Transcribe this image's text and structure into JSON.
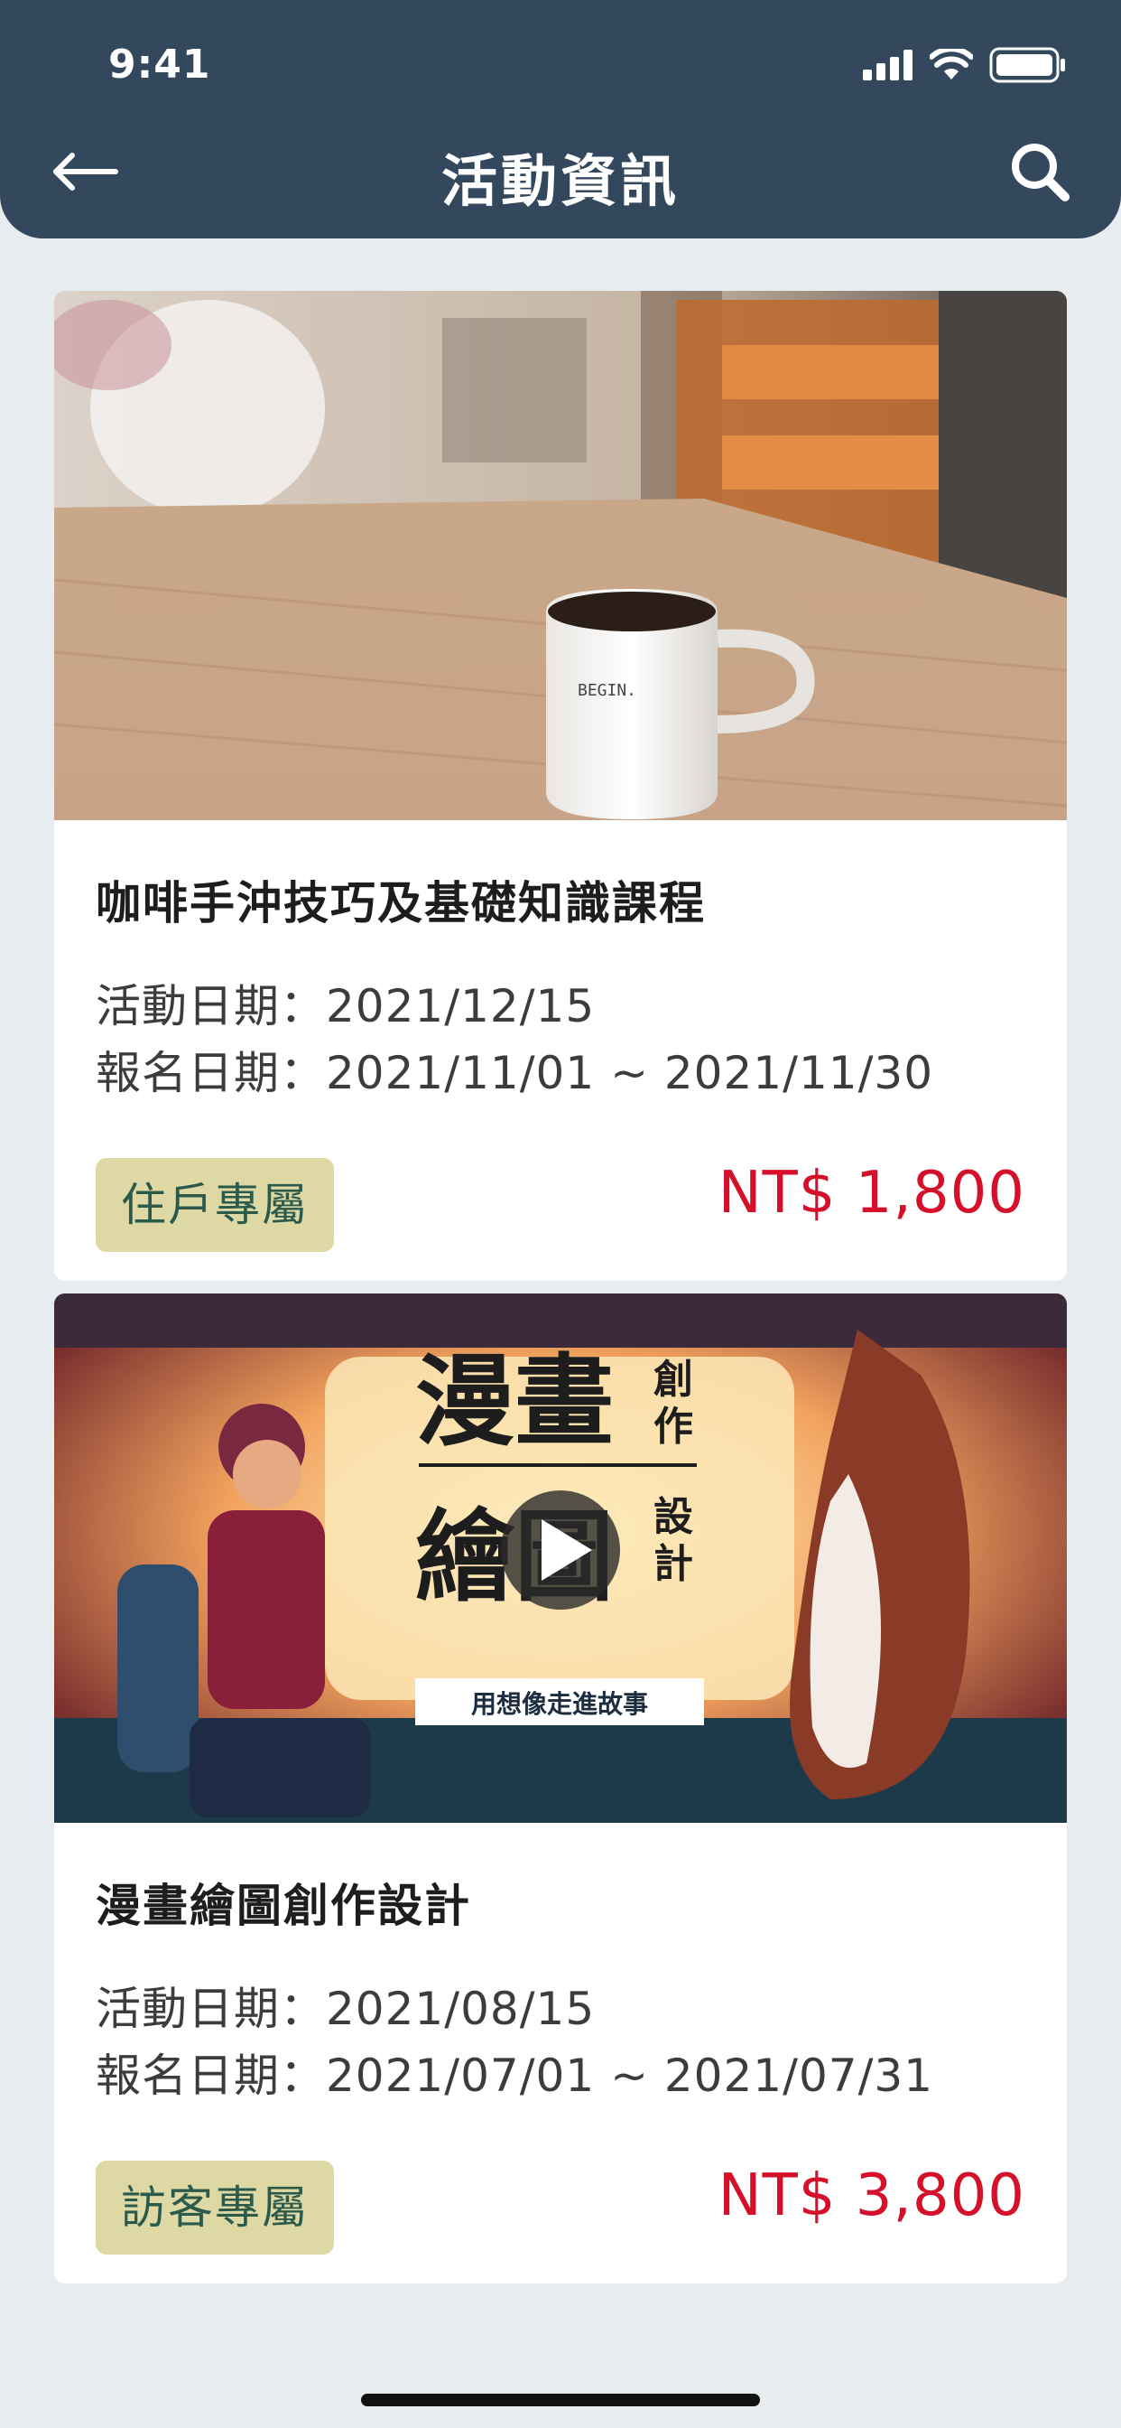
{
  "status_bar": {
    "time": "9:41"
  },
  "header": {
    "title": "活動資訊"
  },
  "events": [
    {
      "title": "咖啡手沖技巧及基礎知識課程",
      "event_date": "活動日期：2021/12/15",
      "signup_date": "報名日期：2021/11/01 ~ 2021/11/30",
      "badge": "住戶專屬",
      "price": "NT$ 1,800",
      "mug_text": "BEGIN."
    },
    {
      "title": "漫畫繪圖創作設計",
      "event_date": "活動日期：2021/08/15",
      "signup_date": "報名日期：2021/07/01 ~ 2021/07/31",
      "badge": "訪客專屬",
      "price": "NT$ 3,800",
      "poster": {
        "big_1": "漫畫",
        "small_1a": "創",
        "small_1b": "作",
        "big_2": "繪圖",
        "small_2a": "設",
        "small_2b": "計",
        "tagline": "用想像走進故事"
      }
    }
  ],
  "colors": {
    "header_bg": "#33475d",
    "page_bg": "#e7ecef",
    "badge_bg": "#ddd8a4",
    "badge_text": "#2b5a4b",
    "price": "#d4102b"
  }
}
